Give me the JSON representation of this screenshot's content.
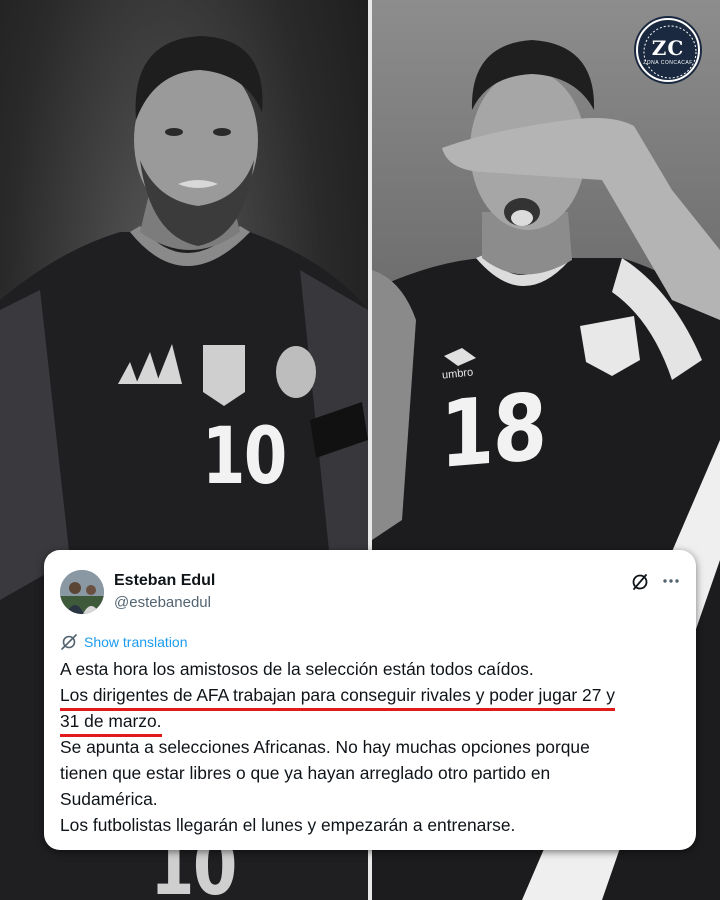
{
  "logo": {
    "mark": "ZC",
    "sub": "ZONA CONCACAF"
  },
  "photos": {
    "left_number": "10",
    "right_number": "18",
    "right_brand": "umbro",
    "bottom_number": "10"
  },
  "tweet": {
    "author_name": "Esteban Edul",
    "author_handle": "@estebanedul",
    "translate_label": "Show translation",
    "lines": [
      "A esta hora los amistosos de la selección están todos caídos.",
      "Los dirigentes de AFA trabajan para conseguir rivales y poder jugar 27 y",
      "31 de marzo.",
      "Se apunta a selecciones Africanas. No hay muchas opciones porque",
      "tienen que estar libres o que ya hayan arreglado otro partido en",
      "Sudamérica.",
      "Los futbolistas llegarán el lunes y empezarán a entrenarse."
    ],
    "highlight_color": "#e21a1a",
    "link_color": "#1d9bf0"
  }
}
